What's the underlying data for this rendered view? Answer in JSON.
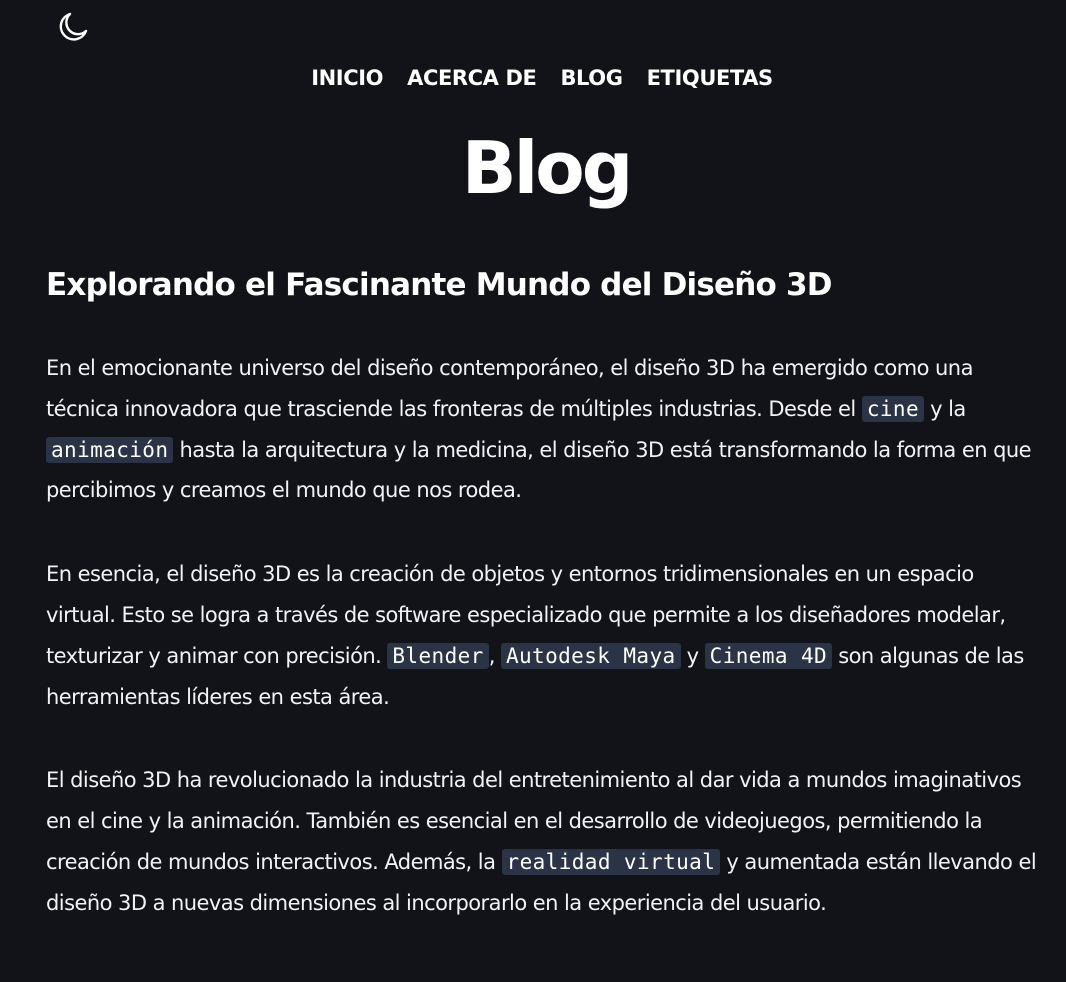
{
  "theme_toggle": {
    "icon": "moon-icon"
  },
  "nav": {
    "items": [
      {
        "label": "INICIO"
      },
      {
        "label": "ACERCA DE"
      },
      {
        "label": "BLOG"
      },
      {
        "label": "ETIQUETAS"
      }
    ]
  },
  "page": {
    "title": "Blog"
  },
  "post": {
    "title": "Explorando el Fascinante Mundo del Diseño 3D",
    "p1": {
      "t1": "En el emocionante universo del diseño contemporáneo, el diseño 3D ha emergido como una técnica innovadora que trasciende las fronteras de múltiples industrias. Desde el ",
      "code1": "cine",
      "t2": " y la ",
      "code2": "animación",
      "t3": " hasta la arquitectura y la medicina, el diseño 3D está transformando la forma en que percibimos y creamos el mundo que nos rodea."
    },
    "p2": {
      "t1": "En esencia, el diseño 3D es la creación de objetos y entornos tridimensionales en un espacio virtual. Esto se logra a través de software especializado que permite a los diseñadores modelar, texturizar y animar con precisión. ",
      "code1": "Blender",
      "t2": ", ",
      "code2": "Autodesk Maya",
      "t3": " y ",
      "code3": "Cinema 4D",
      "t4": " son algunas de las herramientas líderes en esta área."
    },
    "p3": {
      "t1": "El diseño 3D ha revolucionado la industria del entretenimiento al dar vida a mundos imaginativos en el cine y la animación. También es esencial en el desarrollo de videojuegos, permitiendo la creación de mundos interactivos. Además, la ",
      "code1": "realidad virtual",
      "t2": " y aumentada están llevando el diseño 3D a nuevas dimensiones al incorporarlo en la experiencia del usuario."
    }
  }
}
